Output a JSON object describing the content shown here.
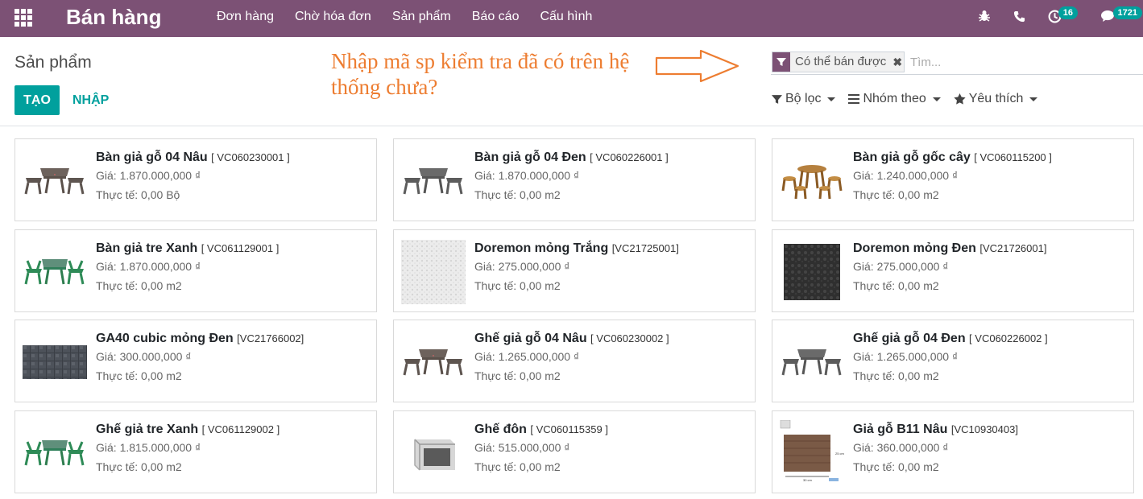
{
  "app": {
    "title": "Bán hàng"
  },
  "menu": [
    "Đơn hàng",
    "Chờ hóa đơn",
    "Sản phẩm",
    "Báo cáo",
    "Cấu hình"
  ],
  "systray": {
    "activity_count": "16",
    "message_count": "1721"
  },
  "breadcrumb": "Sản phẩm",
  "buttons": {
    "create": "TẠO",
    "import": "NHẬP"
  },
  "annotation": "Nhập mã sp kiểm tra đã có trên hệ thống chưa?",
  "search": {
    "facet": "Có thể bán được",
    "placeholder": "Tìm..."
  },
  "filters": {
    "filter": "Bộ lọc",
    "group_by": "Nhóm theo",
    "favorites": "Yêu thích"
  },
  "colors": {
    "brand": "#7c5175",
    "accent": "#00a09d",
    "annotation": "#ed7d31"
  },
  "products": [
    {
      "name": "Bàn giả gỗ 04 Nâu",
      "code": "[ VC060230001 ]",
      "price": "Giá: 1.870.000,000 ₫",
      "qty": "Thực tế: 0,00 Bộ",
      "image": "table-set-brown"
    },
    {
      "name": "Bàn giả gỗ 04 Đen",
      "code": "[ VC060226001 ]",
      "price": "Giá: 1.870.000,000 ₫",
      "qty": "Thực tế: 0,00 m2",
      "image": "table-set-dark"
    },
    {
      "name": "Bàn giả gỗ gốc cây",
      "code": "[ VC060115200 ]",
      "price": "Giá: 1.240.000,000 ₫",
      "qty": "Thực tế: 0,00 m2",
      "image": "stump-table-set"
    },
    {
      "name": "Bàn giả tre Xanh",
      "code": "[ VC061129001 ]",
      "price": "Giá: 1.870.000,000 ₫",
      "qty": "Thực tế: 0,00 m2",
      "image": "table-set-green"
    },
    {
      "name": "Doremon mỏng Trắng",
      "code": "[VC21725001]",
      "price": "Giá: 275.000,000 ₫",
      "qty": "Thực tế: 0,00 m2",
      "image": "white-texture"
    },
    {
      "name": "Doremon mỏng Đen",
      "code": "[VC21726001]",
      "price": "Giá: 275.000,000 ₫",
      "qty": "Thực tế: 0,00 m2",
      "image": "black-texture"
    },
    {
      "name": "GA40 cubic mỏng Đen",
      "code": "[VC21766002]",
      "price": "Giá: 300.000,000 ₫",
      "qty": "Thực tế: 0,00 m2",
      "image": "black-cubic"
    },
    {
      "name": "Ghế giả gỗ 04 Nâu",
      "code": "[ VC060230002 ]",
      "price": "Giá: 1.265.000,000 ₫",
      "qty": "Thực tế: 0,00 m2",
      "image": "table-set-brown"
    },
    {
      "name": "Ghế giả gỗ 04 Đen",
      "code": "[ VC060226002 ]",
      "price": "Giá: 1.265.000,000 ₫",
      "qty": "Thực tế: 0,00 m2",
      "image": "table-set-dark"
    },
    {
      "name": "Ghế giả tre Xanh",
      "code": "[ VC061129002 ]",
      "price": "Giá: 1.815.000,000 ₫",
      "qty": "Thực tế: 0,00 m2",
      "image": "table-set-green"
    },
    {
      "name": "Ghế đôn",
      "code": "[ VC060115359 ]",
      "price": "Giá: 515.000,000 ₫",
      "qty": "Thực tế: 0,00 m2",
      "image": "stool-box"
    },
    {
      "name": "Giả gỗ B11 Nâu",
      "code": "[VC10930403]",
      "price": "Giá: 360.000,000 ₫",
      "qty": "Thực tế: 0,00 m2",
      "image": "wood-tile"
    }
  ]
}
